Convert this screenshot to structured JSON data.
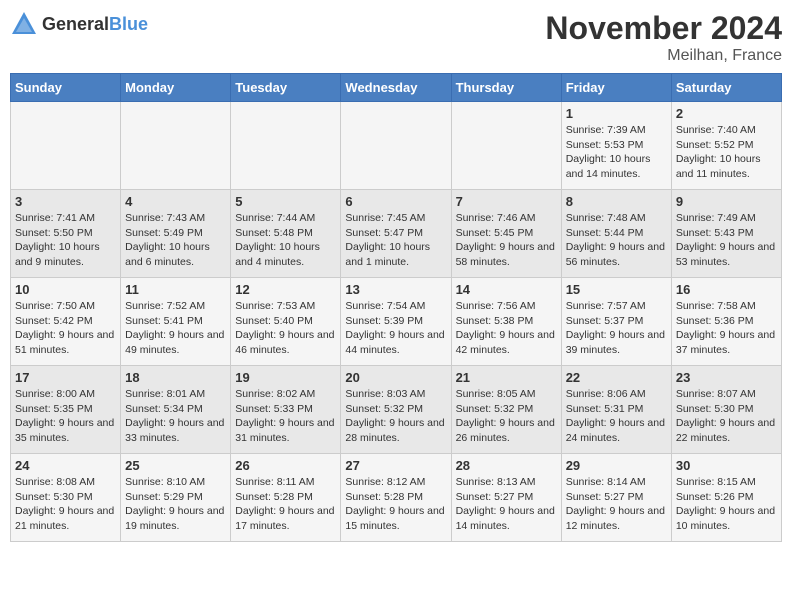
{
  "logo": {
    "general": "General",
    "blue": "Blue"
  },
  "title": "November 2024",
  "subtitle": "Meilhan, France",
  "weekdays": [
    "Sunday",
    "Monday",
    "Tuesday",
    "Wednesday",
    "Thursday",
    "Friday",
    "Saturday"
  ],
  "weeks": [
    [
      {
        "day": "",
        "sunrise": "",
        "sunset": "",
        "daylight": ""
      },
      {
        "day": "",
        "sunrise": "",
        "sunset": "",
        "daylight": ""
      },
      {
        "day": "",
        "sunrise": "",
        "sunset": "",
        "daylight": ""
      },
      {
        "day": "",
        "sunrise": "",
        "sunset": "",
        "daylight": ""
      },
      {
        "day": "",
        "sunrise": "",
        "sunset": "",
        "daylight": ""
      },
      {
        "day": "1",
        "sunrise": "Sunrise: 7:39 AM",
        "sunset": "Sunset: 5:53 PM",
        "daylight": "Daylight: 10 hours and 14 minutes."
      },
      {
        "day": "2",
        "sunrise": "Sunrise: 7:40 AM",
        "sunset": "Sunset: 5:52 PM",
        "daylight": "Daylight: 10 hours and 11 minutes."
      }
    ],
    [
      {
        "day": "3",
        "sunrise": "Sunrise: 7:41 AM",
        "sunset": "Sunset: 5:50 PM",
        "daylight": "Daylight: 10 hours and 9 minutes."
      },
      {
        "day": "4",
        "sunrise": "Sunrise: 7:43 AM",
        "sunset": "Sunset: 5:49 PM",
        "daylight": "Daylight: 10 hours and 6 minutes."
      },
      {
        "day": "5",
        "sunrise": "Sunrise: 7:44 AM",
        "sunset": "Sunset: 5:48 PM",
        "daylight": "Daylight: 10 hours and 4 minutes."
      },
      {
        "day": "6",
        "sunrise": "Sunrise: 7:45 AM",
        "sunset": "Sunset: 5:47 PM",
        "daylight": "Daylight: 10 hours and 1 minute."
      },
      {
        "day": "7",
        "sunrise": "Sunrise: 7:46 AM",
        "sunset": "Sunset: 5:45 PM",
        "daylight": "Daylight: 9 hours and 58 minutes."
      },
      {
        "day": "8",
        "sunrise": "Sunrise: 7:48 AM",
        "sunset": "Sunset: 5:44 PM",
        "daylight": "Daylight: 9 hours and 56 minutes."
      },
      {
        "day": "9",
        "sunrise": "Sunrise: 7:49 AM",
        "sunset": "Sunset: 5:43 PM",
        "daylight": "Daylight: 9 hours and 53 minutes."
      }
    ],
    [
      {
        "day": "10",
        "sunrise": "Sunrise: 7:50 AM",
        "sunset": "Sunset: 5:42 PM",
        "daylight": "Daylight: 9 hours and 51 minutes."
      },
      {
        "day": "11",
        "sunrise": "Sunrise: 7:52 AM",
        "sunset": "Sunset: 5:41 PM",
        "daylight": "Daylight: 9 hours and 49 minutes."
      },
      {
        "day": "12",
        "sunrise": "Sunrise: 7:53 AM",
        "sunset": "Sunset: 5:40 PM",
        "daylight": "Daylight: 9 hours and 46 minutes."
      },
      {
        "day": "13",
        "sunrise": "Sunrise: 7:54 AM",
        "sunset": "Sunset: 5:39 PM",
        "daylight": "Daylight: 9 hours and 44 minutes."
      },
      {
        "day": "14",
        "sunrise": "Sunrise: 7:56 AM",
        "sunset": "Sunset: 5:38 PM",
        "daylight": "Daylight: 9 hours and 42 minutes."
      },
      {
        "day": "15",
        "sunrise": "Sunrise: 7:57 AM",
        "sunset": "Sunset: 5:37 PM",
        "daylight": "Daylight: 9 hours and 39 minutes."
      },
      {
        "day": "16",
        "sunrise": "Sunrise: 7:58 AM",
        "sunset": "Sunset: 5:36 PM",
        "daylight": "Daylight: 9 hours and 37 minutes."
      }
    ],
    [
      {
        "day": "17",
        "sunrise": "Sunrise: 8:00 AM",
        "sunset": "Sunset: 5:35 PM",
        "daylight": "Daylight: 9 hours and 35 minutes."
      },
      {
        "day": "18",
        "sunrise": "Sunrise: 8:01 AM",
        "sunset": "Sunset: 5:34 PM",
        "daylight": "Daylight: 9 hours and 33 minutes."
      },
      {
        "day": "19",
        "sunrise": "Sunrise: 8:02 AM",
        "sunset": "Sunset: 5:33 PM",
        "daylight": "Daylight: 9 hours and 31 minutes."
      },
      {
        "day": "20",
        "sunrise": "Sunrise: 8:03 AM",
        "sunset": "Sunset: 5:32 PM",
        "daylight": "Daylight: 9 hours and 28 minutes."
      },
      {
        "day": "21",
        "sunrise": "Sunrise: 8:05 AM",
        "sunset": "Sunset: 5:32 PM",
        "daylight": "Daylight: 9 hours and 26 minutes."
      },
      {
        "day": "22",
        "sunrise": "Sunrise: 8:06 AM",
        "sunset": "Sunset: 5:31 PM",
        "daylight": "Daylight: 9 hours and 24 minutes."
      },
      {
        "day": "23",
        "sunrise": "Sunrise: 8:07 AM",
        "sunset": "Sunset: 5:30 PM",
        "daylight": "Daylight: 9 hours and 22 minutes."
      }
    ],
    [
      {
        "day": "24",
        "sunrise": "Sunrise: 8:08 AM",
        "sunset": "Sunset: 5:30 PM",
        "daylight": "Daylight: 9 hours and 21 minutes."
      },
      {
        "day": "25",
        "sunrise": "Sunrise: 8:10 AM",
        "sunset": "Sunset: 5:29 PM",
        "daylight": "Daylight: 9 hours and 19 minutes."
      },
      {
        "day": "26",
        "sunrise": "Sunrise: 8:11 AM",
        "sunset": "Sunset: 5:28 PM",
        "daylight": "Daylight: 9 hours and 17 minutes."
      },
      {
        "day": "27",
        "sunrise": "Sunrise: 8:12 AM",
        "sunset": "Sunset: 5:28 PM",
        "daylight": "Daylight: 9 hours and 15 minutes."
      },
      {
        "day": "28",
        "sunrise": "Sunrise: 8:13 AM",
        "sunset": "Sunset: 5:27 PM",
        "daylight": "Daylight: 9 hours and 14 minutes."
      },
      {
        "day": "29",
        "sunrise": "Sunrise: 8:14 AM",
        "sunset": "Sunset: 5:27 PM",
        "daylight": "Daylight: 9 hours and 12 minutes."
      },
      {
        "day": "30",
        "sunrise": "Sunrise: 8:15 AM",
        "sunset": "Sunset: 5:26 PM",
        "daylight": "Daylight: 9 hours and 10 minutes."
      }
    ]
  ]
}
